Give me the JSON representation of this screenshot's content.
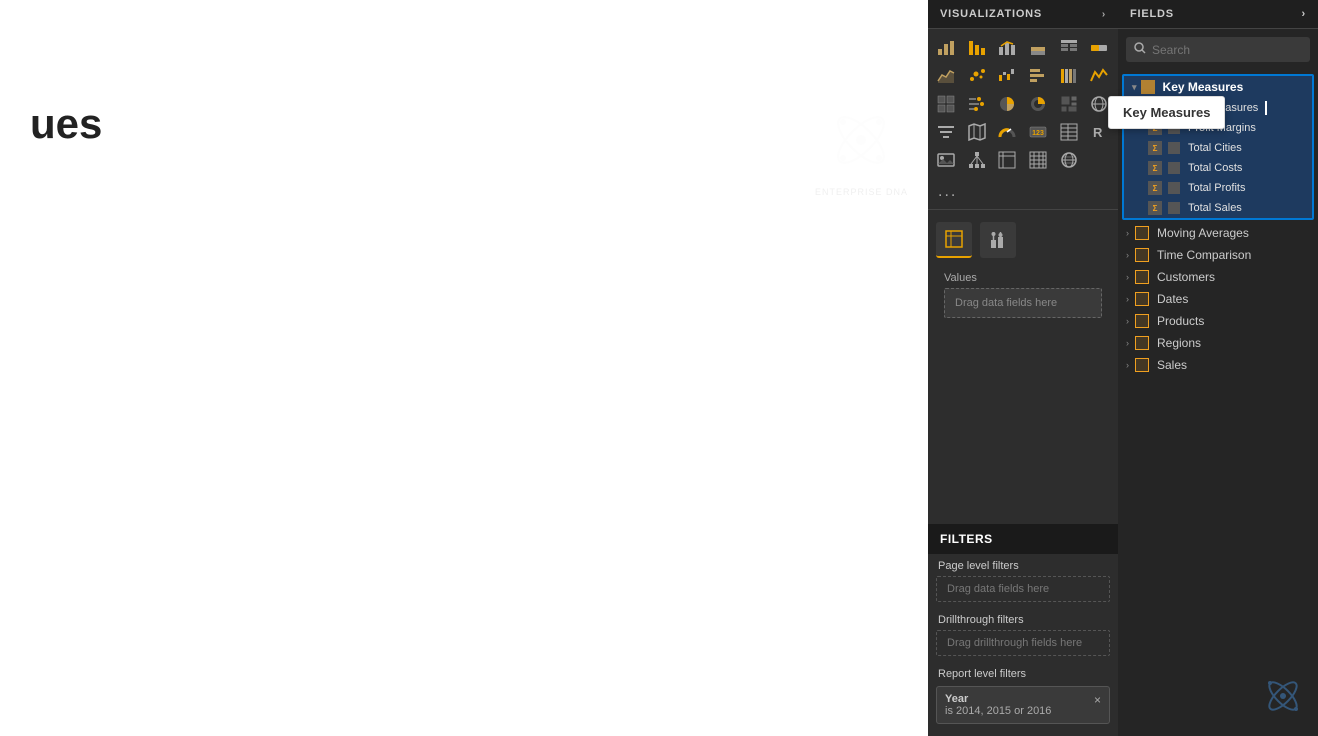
{
  "canvas": {
    "title": "ues",
    "enterprise_label": "ENTERPRISE DNA"
  },
  "viz_panel": {
    "header": "VISUALIZATIONS",
    "header_arrow": "›",
    "more_label": "...",
    "values_label": "Values",
    "drag_hint": "Drag data fields here",
    "filters": {
      "header": "FILTERS",
      "page_level": "Page level filters",
      "page_drag": "Drag data fields here",
      "drillthrough": "Drillthrough filters",
      "drillthrough_drag": "Drag drillthrough fields here",
      "report_level": "Report level filters",
      "chip_title": "Year",
      "chip_value": "is 2014, 2015 or 2016",
      "chip_close": "×"
    }
  },
  "fields_panel": {
    "header": "FIELDS",
    "header_arrow": "›",
    "search_placeholder": "Search",
    "tooltip_text": "Key Measures",
    "groups": [
      {
        "id": "key-measures",
        "label": "Key Measures",
        "expanded": true,
        "highlighted": true,
        "items": [
          {
            "label": "Key Measures",
            "is_header_item": true
          },
          {
            "label": "Profit Margins"
          },
          {
            "label": "Total Cities"
          },
          {
            "label": "Total Costs"
          },
          {
            "label": "Total Profits"
          },
          {
            "label": "Total Sales"
          }
        ]
      },
      {
        "id": "moving-averages",
        "label": "Moving Averages",
        "expanded": false,
        "highlighted": false,
        "items": []
      },
      {
        "id": "time-comparison",
        "label": "Time Comparison",
        "expanded": false,
        "highlighted": false,
        "items": []
      },
      {
        "id": "customers",
        "label": "Customers",
        "expanded": false,
        "highlighted": false,
        "items": []
      },
      {
        "id": "dates",
        "label": "Dates",
        "expanded": false,
        "highlighted": false,
        "items": []
      },
      {
        "id": "products",
        "label": "Products",
        "expanded": false,
        "highlighted": false,
        "items": []
      },
      {
        "id": "regions",
        "label": "Regions",
        "expanded": false,
        "highlighted": false,
        "items": []
      },
      {
        "id": "sales",
        "label": "Sales",
        "expanded": false,
        "highlighted": false,
        "items": []
      }
    ]
  }
}
